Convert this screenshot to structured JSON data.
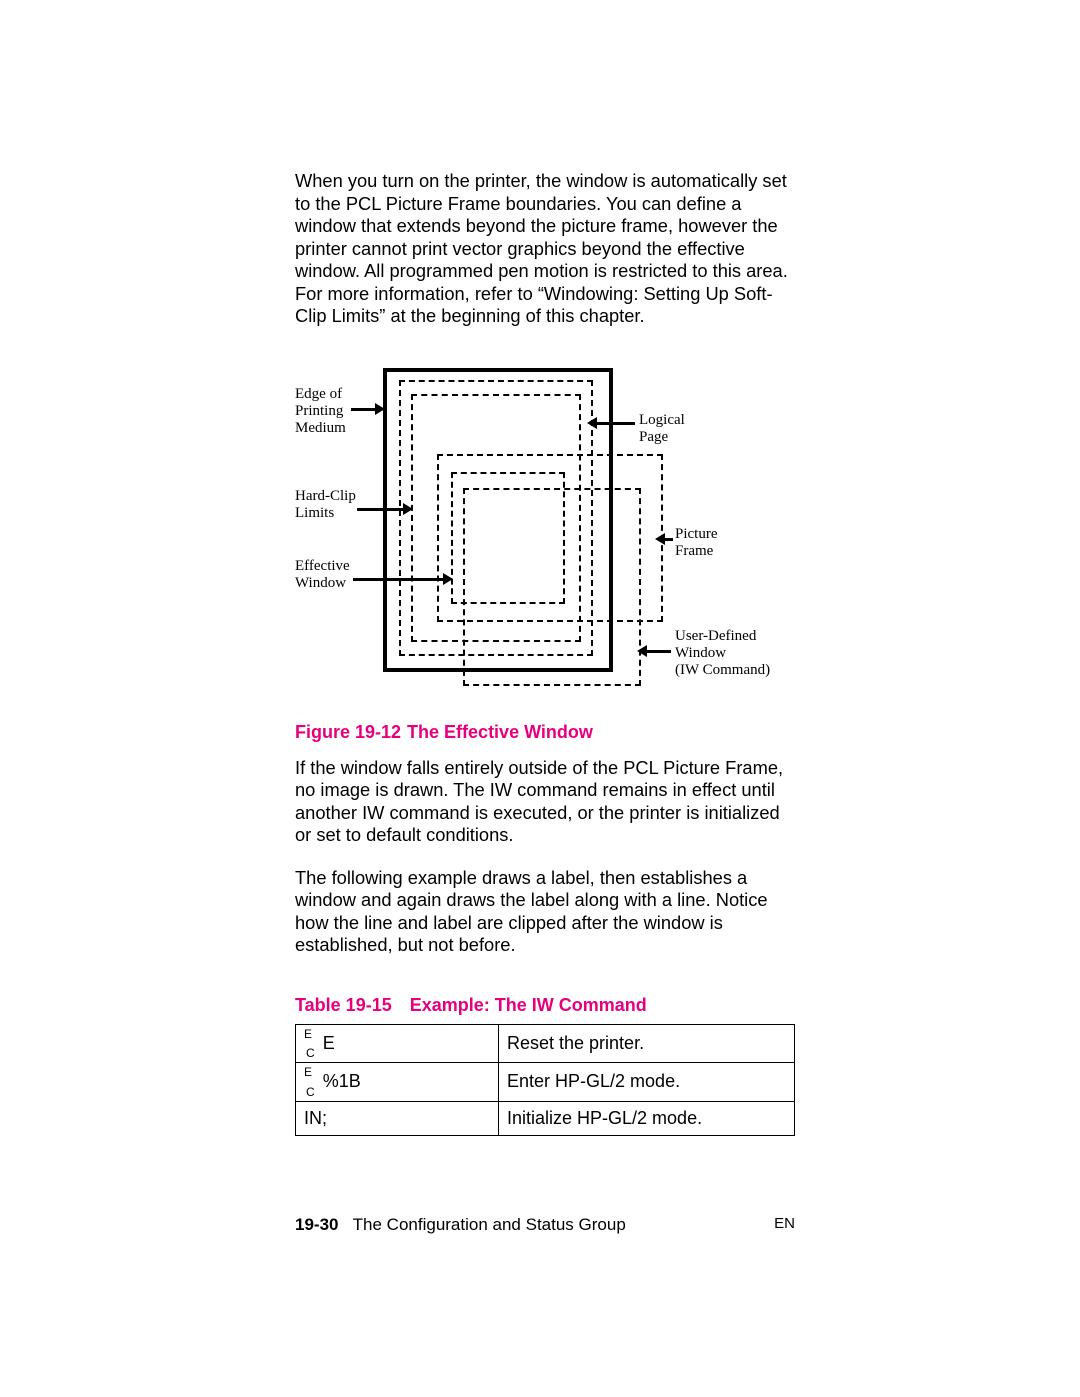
{
  "paragraphs": {
    "p1": "When you turn on the printer, the window is automatically set to the PCL Picture Frame boundaries. You can define a window that extends beyond the picture frame, however the printer cannot print vector graphics beyond the effective window. All programmed pen motion is restricted to this area. For more information, refer to “Windowing: Setting Up Soft-Clip Limits” at the beginning of this chapter.",
    "p2": "If the window falls entirely outside of the PCL Picture Frame, no image is drawn. The IW command remains in effect until another IW command is executed, or the printer is initialized or set to default conditions.",
    "p3": "The following example draws a label, then establishes a window and again draws the label along with a line. Notice how the line and label are clipped after the window is established, but not before."
  },
  "figure": {
    "label": "Figure 19-12",
    "title": "The Effective Window",
    "labels": {
      "edge": "Edge of\nPrinting\nMedium",
      "hardclip": "Hard-Clip\nLimits",
      "effwin": "Effective\nWindow",
      "logical": "Logical\nPage",
      "picframe": "Picture\nFrame",
      "userwin": "User-Defined\nWindow\n(IW Command)"
    }
  },
  "table": {
    "title": "Table 19-15 Example: The IW Command",
    "rows": [
      {
        "cmd_pre": "E",
        "cmd_sub": "C",
        "cmd_post": "E",
        "desc": "Reset the printer."
      },
      {
        "cmd_pre": "E",
        "cmd_sub": "C",
        "cmd_post": "%1B",
        "desc": "Enter HP-GL/2 mode."
      },
      {
        "cmd_plain": "IN;",
        "desc": "Initialize HP-GL/2 mode."
      }
    ]
  },
  "footer": {
    "page_num": "19-30",
    "section": "The Configuration and Status Group",
    "lang": "EN"
  }
}
